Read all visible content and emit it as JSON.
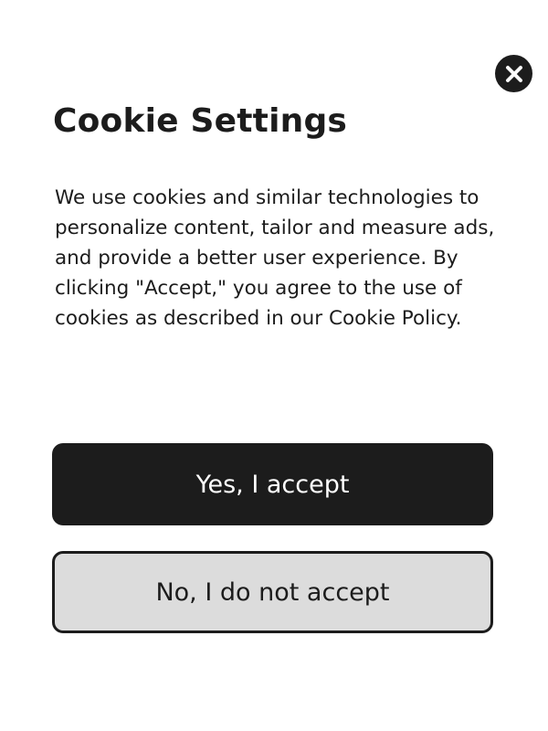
{
  "dialog": {
    "title": "Cookie Settings",
    "body": "We use cookies and similar technologies to personalize content, tailor and measure ads, and provide a better user experience. By clicking \"Accept,\" you agree to the use of cookies as described in our Cookie Policy.",
    "accept_label": "Yes, I accept",
    "decline_label": "No, I do not accept",
    "close_icon": "close-icon"
  },
  "colors": {
    "primary": "#1c1c1c",
    "secondary_bg": "#dcdcdc",
    "background": "#ffffff"
  }
}
